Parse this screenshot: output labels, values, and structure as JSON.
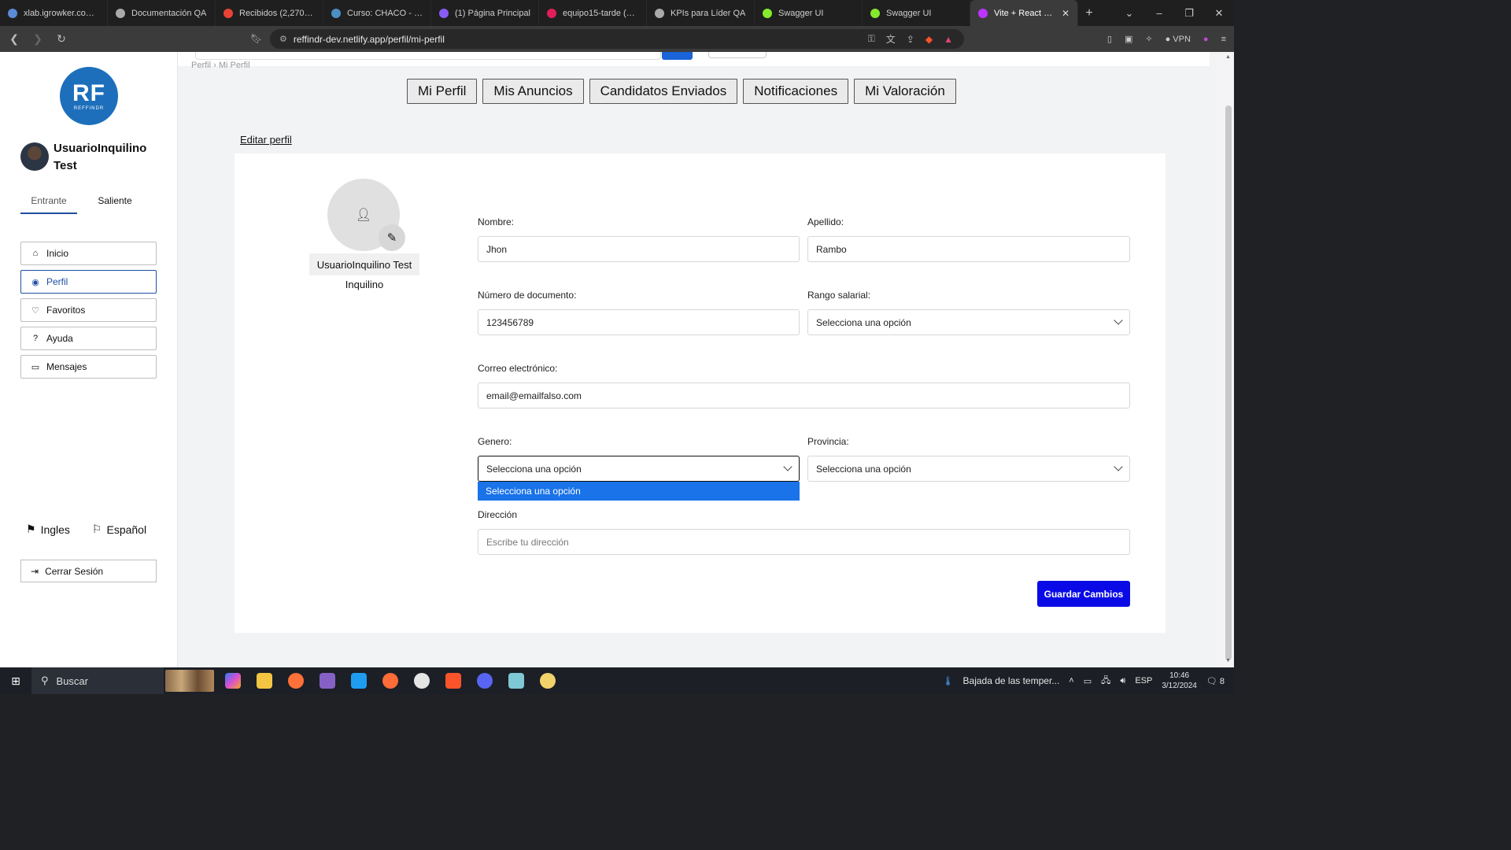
{
  "browser": {
    "tabs": [
      {
        "title": "xlab.igrowker.com/pro",
        "color": "#5a8bd6"
      },
      {
        "title": "Documentación QA",
        "color": "#aaaaaa"
      },
      {
        "title": "Recibidos (2,270) - tim",
        "color": "#ea4335"
      },
      {
        "title": "Curso: CHACO - Perfil",
        "color": "#4a90c2"
      },
      {
        "title": "(1) Página Principal",
        "color": "#8a5cf6"
      },
      {
        "title": "equipo15-tarde (Cana",
        "color": "#e01e5a"
      },
      {
        "title": "KPIs para Líder QA",
        "color": "#aaaaaa"
      },
      {
        "title": "Swagger UI",
        "color": "#85ea2d"
      },
      {
        "title": "Swagger UI",
        "color": "#85ea2d"
      },
      {
        "title": "Vite + React + TS",
        "color": "#bd34fe"
      }
    ],
    "url": "reffindr-dev.netlify.app/perfil/mi-perfil",
    "vpn_label": "VPN"
  },
  "sidebar": {
    "logo_big": "RF",
    "logo_small": "REFFINDR",
    "user_name": "UsuarioInquilino Test",
    "io_tabs": [
      "Entrante",
      "Saliente"
    ],
    "menu": [
      "Inicio",
      "Perfil",
      "Favoritos",
      "Ayuda",
      "Mensajes"
    ],
    "langs": [
      "Ingles",
      "Español"
    ],
    "logout": "Cerrar Sesión"
  },
  "main": {
    "breadcrumb": "Perfil  ›  Mi Perfil",
    "profile_tabs": [
      "Mi Perfil",
      "Mis Anuncios",
      "Candidatos Enviados",
      "Notificaciones",
      "Mi Valoración"
    ],
    "edit_link": "Editar perfil",
    "profile_name": "UsuarioInquilino Test",
    "profile_role": "Inquilino",
    "form": {
      "nombre_label": "Nombre:",
      "nombre_value": "Jhon",
      "apellido_label": "Apellido:",
      "apellido_value": "Rambo",
      "documento_label": "Número de documento:",
      "documento_value": "123456789",
      "rango_label": "Rango salarial:",
      "rango_value": "Selecciona una opción",
      "correo_label": "Correo electrónico:",
      "correo_value": "email@emailfalso.com",
      "genero_label": "Genero:",
      "genero_value": "Selecciona una opción",
      "genero_open_option": "Selecciona una opción",
      "provincia_label": "Provincia:",
      "provincia_value": "Selecciona una opción",
      "direccion_label": "Dirección",
      "direccion_placeholder": "Escribe tu dirección",
      "save_label": "Guardar Cambios"
    }
  },
  "taskbar": {
    "search_placeholder": "Buscar",
    "weather": "Bajada de las temper...",
    "lang": "ESP",
    "time": "10:46",
    "date": "3/12/2024",
    "notif_count": "8"
  }
}
